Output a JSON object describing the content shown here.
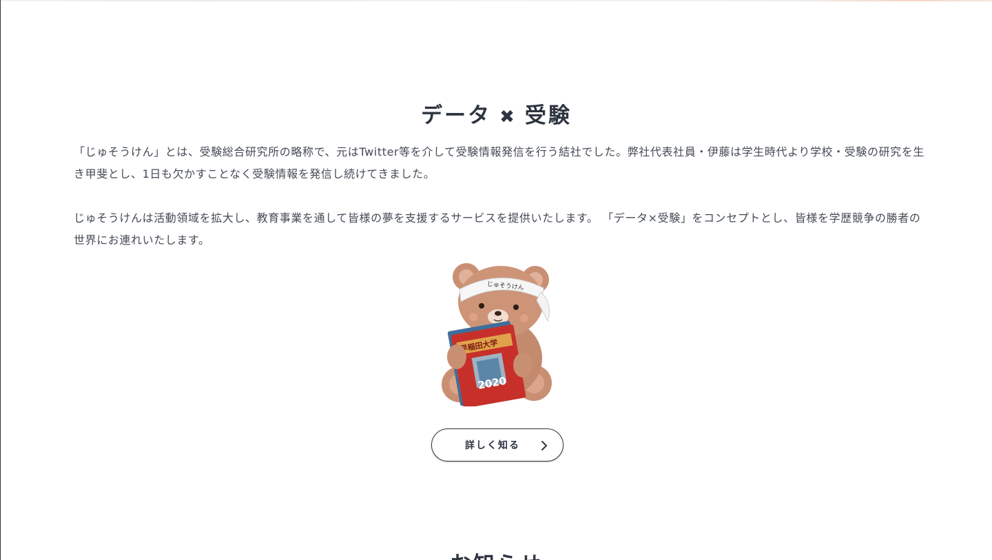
{
  "about": {
    "title_left": "データ",
    "title_cross": "✖",
    "title_right": "受験",
    "paragraph_1": "「じゅそうけん」とは、受験総合研究所の略称で、元はTwitter等を介して受験情報発信を行う結社でした。弊社代表社員・伊藤は学生時代より学校・受験の研究を生き甲斐とし、1日も欠かすことなく受験情報を発信し続けてきました。",
    "paragraph_2": "じゅそうけんは活動領域を拡大し、教育事業を通して皆様の夢を支援するサービスを提供いたします。 「データ×受験」をコンセプトとし、皆様を学歴競争の勝者の世界にお連れいたします。",
    "mascot": {
      "headband_text": "じゅそうけん",
      "book_title": "早稲田大学",
      "book_year": "2020"
    },
    "more_button_label": "詳しく知る"
  },
  "news": {
    "title": "お知らせ"
  },
  "colors": {
    "text_dark": "#2e3440",
    "body_text": "#444a55",
    "bear_fur": "#c98f73",
    "book_red": "#c7302a"
  }
}
